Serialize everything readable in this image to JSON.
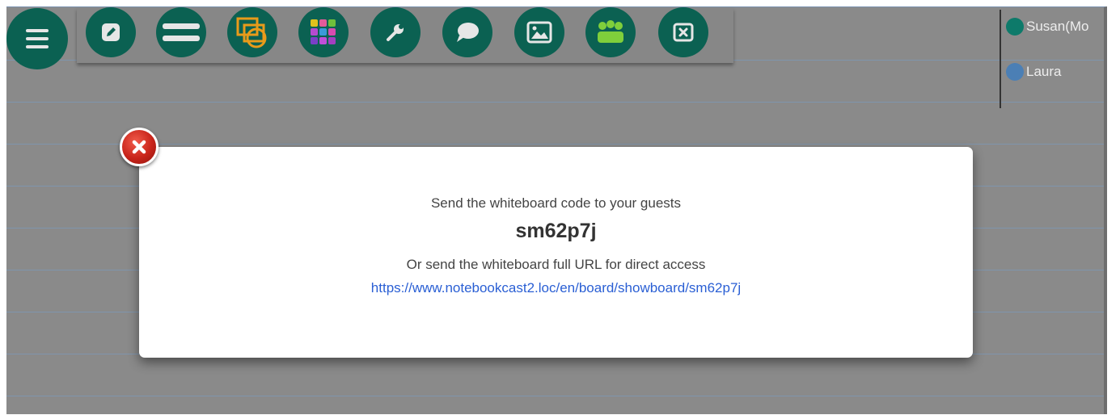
{
  "toolbar": {
    "icons": [
      "menu-icon",
      "edit-icon",
      "lines-icon",
      "shapes-icon",
      "color-palette-icon",
      "wrench-icon",
      "chat-icon",
      "image-icon",
      "users-icon",
      "close-board-icon"
    ],
    "button_color": "#0b6152"
  },
  "participants": [
    {
      "name": "Susan(Mo",
      "color": "#0d7a6a"
    },
    {
      "name": "Laura",
      "color": "#4b7fb5"
    }
  ],
  "modal": {
    "instruction": "Send the whiteboard code to your guests",
    "code": "sm62p7j",
    "url_instruction": "Or send the whiteboard full URL for direct access",
    "url": "https://www.notebookcast2.loc/en/board/showboard/sm62p7j",
    "close_icon": "close-icon"
  }
}
